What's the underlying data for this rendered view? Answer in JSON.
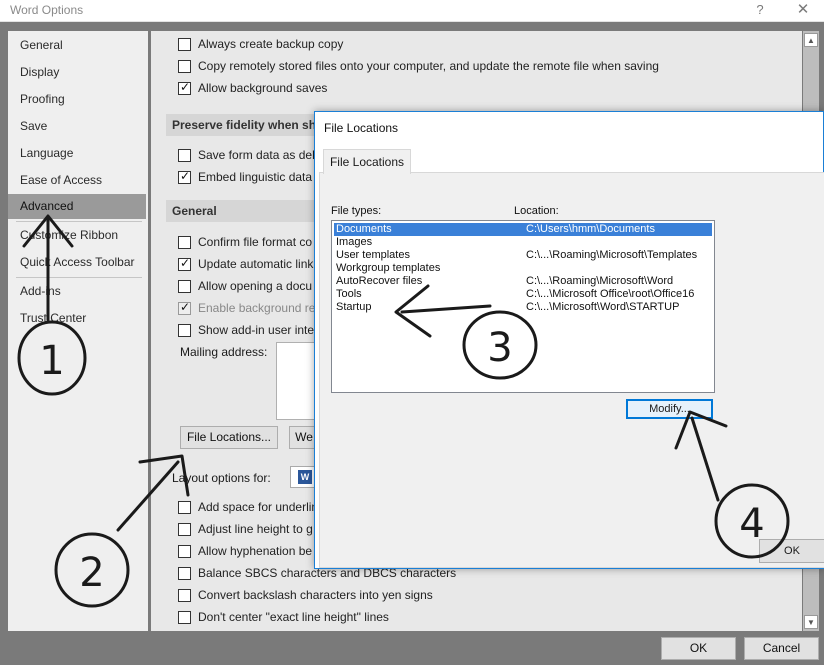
{
  "window": {
    "title": "Word Options",
    "help_icon": "?",
    "close_icon": "✕"
  },
  "sidebar": {
    "items": [
      {
        "label": "General"
      },
      {
        "label": "Display"
      },
      {
        "label": "Proofing"
      },
      {
        "label": "Save"
      },
      {
        "label": "Language"
      },
      {
        "label": "Ease of Access"
      },
      {
        "label": "Advanced",
        "active": true
      },
      {
        "label": "Customize Ribbon"
      },
      {
        "label": "Quick Access Toolbar"
      },
      {
        "label": "Add-ins"
      },
      {
        "label": "Trust Center"
      }
    ]
  },
  "advanced": {
    "save_options": [
      {
        "label": "Always create backup copy",
        "checked": false
      },
      {
        "label": "Copy remotely stored files onto your computer, and update the remote file when saving",
        "checked": false
      },
      {
        "label": "Allow background saves",
        "checked": true
      }
    ],
    "section_fidelity": "Preserve fidelity when sh",
    "fidelity_options": [
      {
        "label": "Save form data as deli",
        "checked": false
      },
      {
        "label": "Embed linguistic data",
        "checked": true
      }
    ],
    "section_general": "General",
    "general_options": [
      {
        "label": "Confirm file format co",
        "checked": false
      },
      {
        "label": "Update automatic link",
        "checked": true
      },
      {
        "label": "Allow opening a docu",
        "checked": false
      },
      {
        "label": "Enable background re",
        "checked": true,
        "disabled": true
      },
      {
        "label": "Show add-in user inte",
        "checked": false
      }
    ],
    "mailing_address_label": "Mailing address:",
    "file_locations_button": "File Locations...",
    "web_options_button": "We",
    "layout_options_label": "Layout options for:",
    "layout_options": [
      {
        "label": "Add space for underlin",
        "checked": false
      },
      {
        "label": "Adjust line height to g",
        "checked": false
      },
      {
        "label": "Allow hyphenation be",
        "checked": false
      },
      {
        "label": "Balance SBCS characters and DBCS characters",
        "checked": false
      },
      {
        "label": "Convert backslash characters into yen signs",
        "checked": false
      },
      {
        "label": "Don't center \"exact line height\" lines",
        "checked": false
      }
    ]
  },
  "footer": {
    "ok_label": "OK",
    "cancel_label": "Cancel"
  },
  "dialog": {
    "title": "File Locations",
    "tab_label": "File Locations",
    "col_file_types": "File types:",
    "col_location": "Location:",
    "rows": [
      {
        "type": "Documents",
        "location": "C:\\Users\\hmm\\Documents",
        "selected": true
      },
      {
        "type": "Images",
        "location": ""
      },
      {
        "type": "User templates",
        "location": "C:\\...\\Roaming\\Microsoft\\Templates"
      },
      {
        "type": "Workgroup templates",
        "location": ""
      },
      {
        "type": "AutoRecover files",
        "location": "C:\\...\\Roaming\\Microsoft\\Word"
      },
      {
        "type": "Tools",
        "location": "C:\\...\\Microsoft Office\\root\\Office16"
      },
      {
        "type": "Startup",
        "location": "C:\\...\\Microsoft\\Word\\STARTUP"
      }
    ],
    "modify_button": "Modify...",
    "ok_button": "OK"
  },
  "annotations": {
    "n1": "1",
    "n2": "2",
    "n3": "3",
    "n4": "4"
  }
}
